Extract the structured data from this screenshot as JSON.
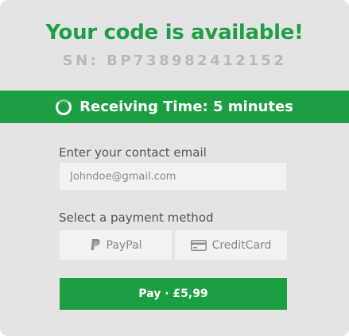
{
  "header": {
    "title": "Your code is available!",
    "serial": "SN: BP738982412152"
  },
  "banner": {
    "icon": "loading-spinner-icon",
    "text": "Receiving Time: 5 minutes"
  },
  "form": {
    "email_label": "Enter your contact email",
    "email_placeholder": "Johndoe@gmail.com",
    "payment_label": "Select a payment method",
    "payment_options": [
      {
        "label": "PayPal",
        "icon": "paypal-icon"
      },
      {
        "label": "CreditCard",
        "icon": "credit-card-icon"
      }
    ],
    "pay_button": "Pay · £5,99"
  },
  "colors": {
    "accent": "#1c9f43",
    "card_background": "#e4e4e4",
    "muted_text": "#b8b8b8"
  }
}
